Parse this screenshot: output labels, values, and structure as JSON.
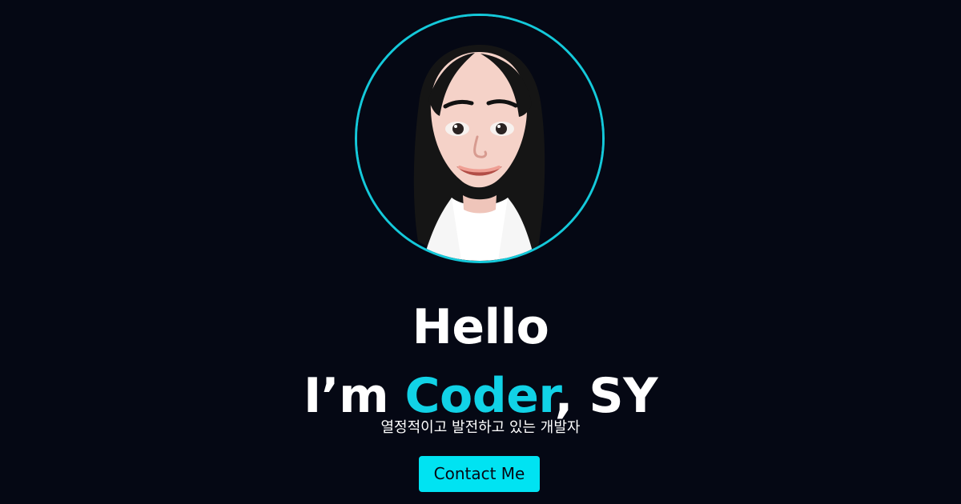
{
  "hero": {
    "avatar_icon": "avatar-image",
    "headline_line_1": "Hello",
    "headline_prefix": "I’m ",
    "headline_accent": "Coder",
    "headline_suffix": ", SY",
    "subtitle": "열정적이고 발전하고 있는 개발자",
    "button_label": "Contact Me"
  },
  "colors": {
    "background": "#050814",
    "accent": "#11d2e6",
    "button": "#00e3f2",
    "text": "#ffffff"
  }
}
